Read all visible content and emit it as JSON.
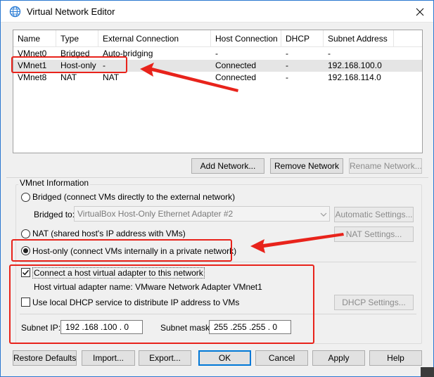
{
  "window": {
    "title": "Virtual Network Editor"
  },
  "table": {
    "columns": [
      "Name",
      "Type",
      "External Connection",
      "Host Connection",
      "DHCP",
      "Subnet Address"
    ],
    "rows": [
      {
        "name": "VMnet0",
        "type": "Bridged",
        "external": "Auto-bridging",
        "host": "-",
        "dhcp": "-",
        "subnet": "-"
      },
      {
        "name": "VMnet1",
        "type": "Host-only",
        "external": "-",
        "host": "Connected",
        "dhcp": "-",
        "subnet": "192.168.100.0"
      },
      {
        "name": "VMnet8",
        "type": "NAT",
        "external": "NAT",
        "host": "Connected",
        "dhcp": "-",
        "subnet": "192.168.114.0"
      }
    ],
    "selected_row": 1
  },
  "table_buttons": {
    "add": "Add Network...",
    "remove": "Remove Network",
    "rename": "Rename Network..."
  },
  "vmnet_info": {
    "group_label": "VMnet Information",
    "bridged_label": "Bridged (connect VMs directly to the external network)",
    "bridged_to_label": "Bridged to:",
    "bridged_to_value": "VirtualBox Host-Only Ethernet Adapter #2",
    "automatic_settings": "Automatic Settings...",
    "nat_label": "NAT (shared host's IP address with VMs)",
    "nat_settings": "NAT Settings...",
    "hostonly_label": "Host-only (connect VMs internally in a private network)",
    "selected_mode": "host-only",
    "connect_adapter_label": "Connect a host virtual adapter to this network",
    "connect_adapter_checked": true,
    "adapter_name_text": "Host virtual adapter name: VMware Network Adapter VMnet1",
    "dhcp_label": "Use local DHCP service to distribute IP address to VMs",
    "dhcp_checked": false,
    "dhcp_settings": "DHCP Settings...",
    "subnet_ip_label": "Subnet IP:",
    "subnet_ip_value": "192 .168 .100 .  0",
    "subnet_mask_label": "Subnet mask:",
    "subnet_mask_value": "255 .255 .255 .  0"
  },
  "footer": {
    "restore": "Restore Defaults",
    "import": "Import...",
    "export": "Export...",
    "ok": "OK",
    "cancel": "Cancel",
    "apply": "Apply",
    "help": "Help"
  },
  "icons": {
    "app": "globe-icon",
    "close": "close-icon",
    "combo_arrow": "chevron-down-icon"
  },
  "colors": {
    "annotation_red": "#e8231b",
    "window_border": "#2b78d0",
    "selected_row": "#e5e5e5"
  }
}
